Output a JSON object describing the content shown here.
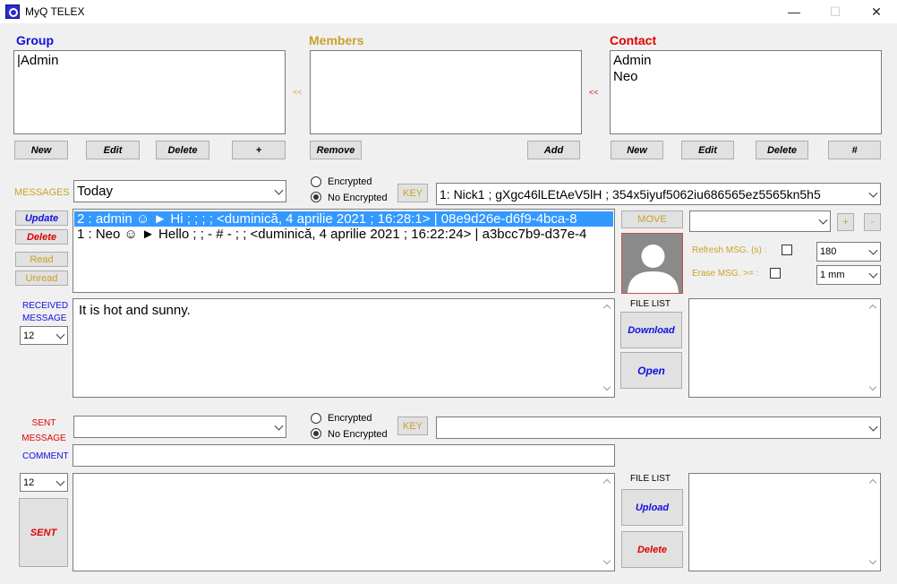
{
  "window": {
    "title": "MyQ TELEX",
    "minimize": "—",
    "maximize": "☐",
    "close": "✕"
  },
  "colors": {
    "group": "#1010e0",
    "members": "#c9a227",
    "contact": "#e00000",
    "selection": "#3399ff"
  },
  "group": {
    "label": "Group",
    "items": [
      "|Admin"
    ],
    "buttons": {
      "new": "New",
      "edit": "Edit",
      "delete": "Delete",
      "plus": "+"
    }
  },
  "members": {
    "label": "Members",
    "items": [],
    "arrow_left": "<<",
    "arrow_right": "<<",
    "buttons": {
      "remove": "Remove",
      "add": "Add"
    }
  },
  "contact": {
    "label": "Contact",
    "items": [
      "Admin",
      "Neo"
    ],
    "buttons": {
      "new": "New",
      "edit": "Edit",
      "delete": "Delete",
      "hash": "#"
    }
  },
  "messages": {
    "label": "MESSAGES",
    "filter_value": "Today",
    "encrypted_label": "Encrypted",
    "no_encrypted_label": "No Encrypted",
    "key_label": "KEY",
    "key_value": "1: Nick1 ; gXgc46lLEtAeV5lH ; 354x5iyuf5062iu686565ez5565kn5h5",
    "buttons": {
      "update": "Update",
      "delete": "Delete",
      "read": "Read",
      "unread": "Unread"
    },
    "rows": [
      "2 : admin ☺ ► Hi  ;  ;  ;  ; <duminică, 4 aprilie 2021 ; 16:28:1> | 08e9d26e-d6f9-4bca-8",
      "1 : Neo ☺ ► Hello  ;  ; - # - ;  ; <duminică, 4 aprilie 2021 ; 16:22:24> | a3bcc7b9-d37e-4"
    ],
    "move_label": "MOVE",
    "move_target": "",
    "plus": "+",
    "minus": "-",
    "refresh_label": "Refresh MSG. (s) :",
    "refresh_value": "180",
    "erase_label": "Erase MSG. >= :",
    "erase_value": "1 mm"
  },
  "received": {
    "label_line1": "RECEIVED",
    "label_line2": "MESSAGE",
    "font_size": "12",
    "text": "It is hot and sunny.",
    "file_list_label": "FILE LIST",
    "download": "Download",
    "open": "Open"
  },
  "sent": {
    "label_line1": "SENT",
    "label_line2": "MESSAGE",
    "comment_label": "COMMENT",
    "encrypted_label": "Encrypted",
    "no_encrypted_label": "No Encrypted",
    "key_label": "KEY",
    "key_value": "",
    "recipient_value": "",
    "comment_value": "",
    "font_size": "12",
    "text": "",
    "sent_button": "SENT",
    "file_list_label": "FILE LIST",
    "upload": "Upload",
    "delete": "Delete"
  }
}
